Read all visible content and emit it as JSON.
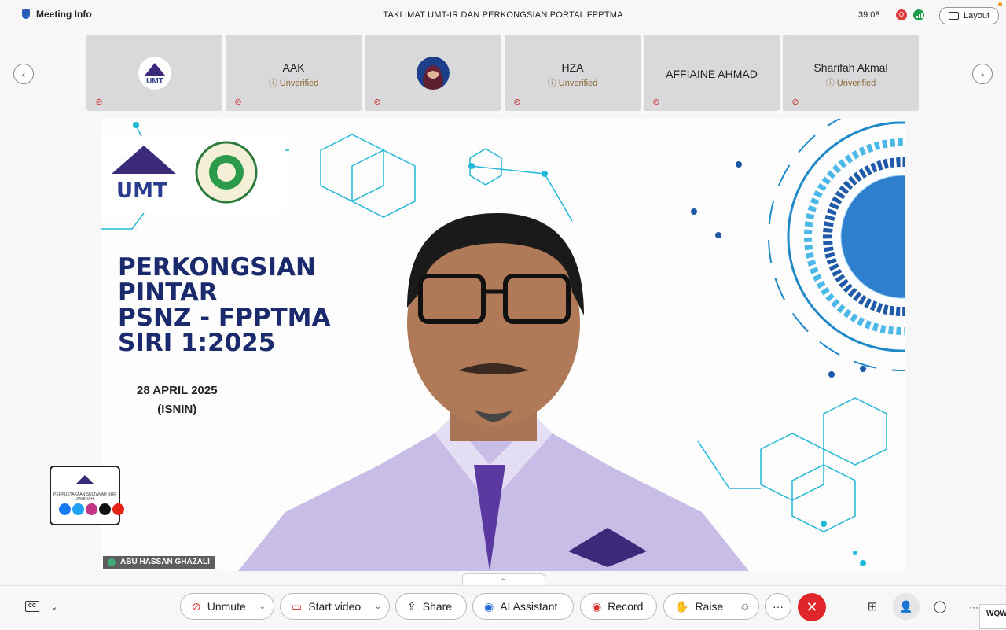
{
  "topbar": {
    "meeting_info": "Meeting Info",
    "title": "TAKLIMAT UMT-IR DAN PERKONGSIAN PORTAL FPPTMA",
    "timer": "39:08",
    "layout_label": "Layout"
  },
  "participants": [
    {
      "name": "",
      "status": "",
      "avatar": "umt-logo"
    },
    {
      "name": "AAK",
      "status": "Unverified"
    },
    {
      "name": "",
      "status": "",
      "avatar": "photo"
    },
    {
      "name": "HZA",
      "status": "Unverified"
    },
    {
      "name": "AFFIAINE AHMAD",
      "status": ""
    },
    {
      "name": "Sharifah Akmal",
      "status": "Unverified"
    }
  ],
  "slide": {
    "logo_text": "UMT",
    "heading_lines": [
      "PERKONGSIAN",
      "PINTAR",
      "PSNZ - FPPTMA",
      "SIRI 1:2025"
    ],
    "date": "28 APRIL 2025",
    "day": "(ISNIN)",
    "sticker_text": "PERPUSTAKAAN SULTANAH NUR ZAHIRAH"
  },
  "speaker": {
    "name": "ABU HASSAN GHAZALI"
  },
  "toolbar": {
    "unmute": "Unmute",
    "start_video": "Start video",
    "share": "Share",
    "ai_assistant": "AI Assistant",
    "record": "Record",
    "raise": "Raise",
    "more": "···",
    "side_label": "WQW"
  },
  "colors": {
    "leave": "#e0262a",
    "accent_blue": "#1a2a6c",
    "cyan": "#22b8d8"
  }
}
